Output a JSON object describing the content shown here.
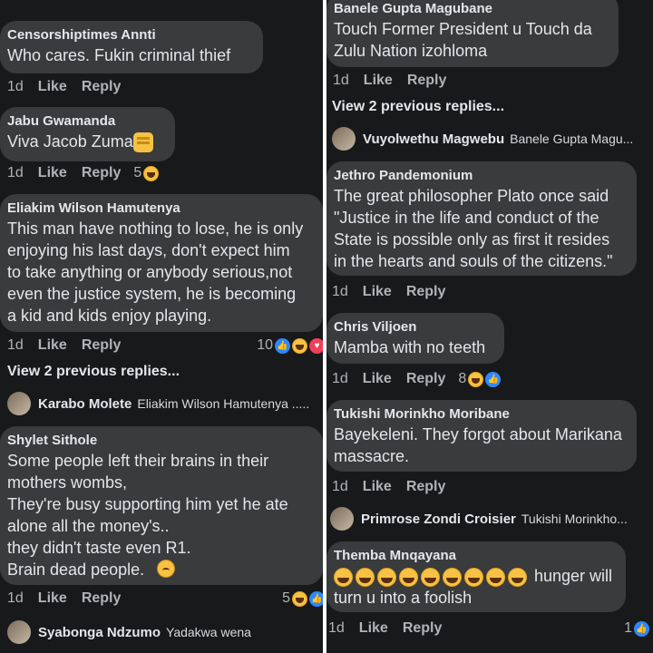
{
  "left": {
    "c1": {
      "author": "Censorshiptimes Annti",
      "text": "Who cares.  Fukin criminal thief",
      "time": "1d",
      "like": "Like",
      "reply": "Reply"
    },
    "c2": {
      "author": "Jabu Gwamanda",
      "text": "Viva Jacob Zuma",
      "time": "1d",
      "like": "Like",
      "reply": "Reply",
      "react_count": "5"
    },
    "c3": {
      "author": "Eliakim Wilson Hamutenya",
      "text": "This man have nothing to lose, he is only\nenjoying his last days, don't expect him\nto take anything or anybody serious,not\neven the justice system, he is becoming\na kid and kids enjoy playing.",
      "time": "1d",
      "like": "Like",
      "reply": "Reply",
      "react_count": "10"
    },
    "view_prev": "View 2 previous replies...",
    "reply1": {
      "name": "Karabo Molete",
      "target": "Eliakim Wilson Hamutenya ....."
    },
    "c4": {
      "author": "Shylet Sithole",
      "text": "Some people left their brains in their\nmothers wombs,\nThey're busy supporting him yet he ate\nalone all the money's..\nthey didn't taste even R1.\nBrain dead people.",
      "time": "1d",
      "like": "Like",
      "reply": "Reply",
      "react_count": "5"
    },
    "reply2": {
      "name": "Syabonga Ndzumo",
      "target": "Yadakwa wena"
    }
  },
  "right": {
    "c1": {
      "author": "Banele Gupta Magubane",
      "text": "Touch Former President u Touch da\nZulu Nation  izohloma",
      "time": "1d",
      "like": "Like",
      "reply": "Reply"
    },
    "view_prev": "View 2 previous replies...",
    "reply1": {
      "name": "Vuyolwethu Magwebu",
      "target": "Banele Gupta Magu..."
    },
    "c2": {
      "author": "Jethro Pandemonium",
      "text": "The great philosopher Plato once said\n\"Justice in the life and conduct of the\nState is possible only as first it resides\nin the hearts and souls of the citizens.\"",
      "time": "1d",
      "like": "Like",
      "reply": "Reply"
    },
    "c3": {
      "author": "Chris Viljoen",
      "text": "Mamba with no teeth",
      "time": "1d",
      "like": "Like",
      "reply": "Reply",
      "react_count": "8"
    },
    "c4": {
      "author": "Tukishi Morinkho Moribane",
      "text": "Bayekeleni. They forgot about Marikana\nmassacre.",
      "time": "1d",
      "like": "Like",
      "reply": "Reply"
    },
    "reply2": {
      "name": "Primrose Zondi Croisier",
      "target": "Tukishi Morinkho..."
    },
    "c5": {
      "author": "Themba Mnqayana",
      "text_line1": " hunger will",
      "text_line2": "turn u into a foolish",
      "time": "1d",
      "like": "Like",
      "reply": "Reply",
      "react_count": "1"
    }
  },
  "colors": {
    "background": "#18191a",
    "bubble": "#3a3b3c",
    "text": "#e4e6eb",
    "muted": "#b0b3b8",
    "like_blue": "#2d88ff"
  }
}
